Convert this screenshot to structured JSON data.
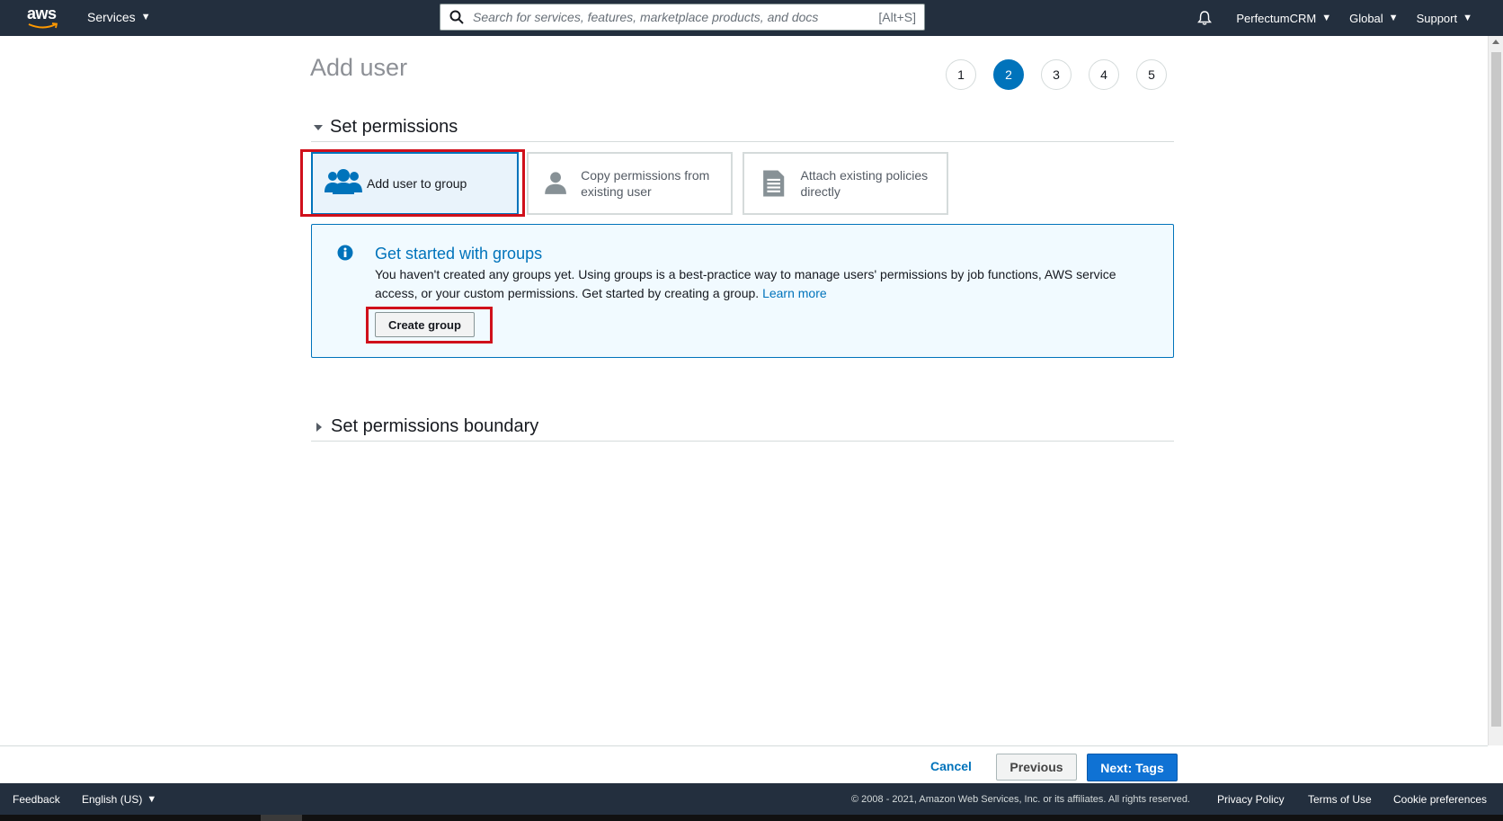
{
  "topnav": {
    "logo_text": "aws",
    "services_label": "Services",
    "search_placeholder": "Search for services, features, marketplace products, and docs",
    "search_shortcut": "[Alt+S]",
    "account_label": "PerfectumCRM",
    "region_label": "Global",
    "support_label": "Support"
  },
  "page": {
    "title": "Add user",
    "steps": [
      "1",
      "2",
      "3",
      "4",
      "5"
    ],
    "active_step": "2"
  },
  "permissions": {
    "section_title": "Set permissions",
    "options": [
      {
        "label": "Add user to group",
        "icon": "group-icon",
        "selected": true
      },
      {
        "label": "Copy permissions from existing user",
        "icon": "user-icon",
        "selected": false
      },
      {
        "label": "Attach existing policies directly",
        "icon": "document-icon",
        "selected": false
      }
    ],
    "info": {
      "title": "Get started with groups",
      "body": "You haven't created any groups yet. Using groups is a best-practice way to manage users' permissions by job functions, AWS service access, or your custom permissions. Get started by creating a group.",
      "link": "Learn more",
      "button": "Create group"
    }
  },
  "boundary": {
    "section_title": "Set permissions boundary"
  },
  "actions": {
    "cancel": "Cancel",
    "previous": "Previous",
    "next": "Next: Tags"
  },
  "footer": {
    "feedback": "Feedback",
    "language": "English (US)",
    "copyright": "© 2008 - 2021, Amazon Web Services, Inc. or its affiliates. All rights reserved.",
    "privacy": "Privacy Policy",
    "terms": "Terms of Use",
    "cookie": "Cookie preferences"
  },
  "colors": {
    "nav_bg": "#232f3e",
    "accent": "#0073bb",
    "primary_button": "#0f72d4",
    "highlight": "#d0101b"
  }
}
